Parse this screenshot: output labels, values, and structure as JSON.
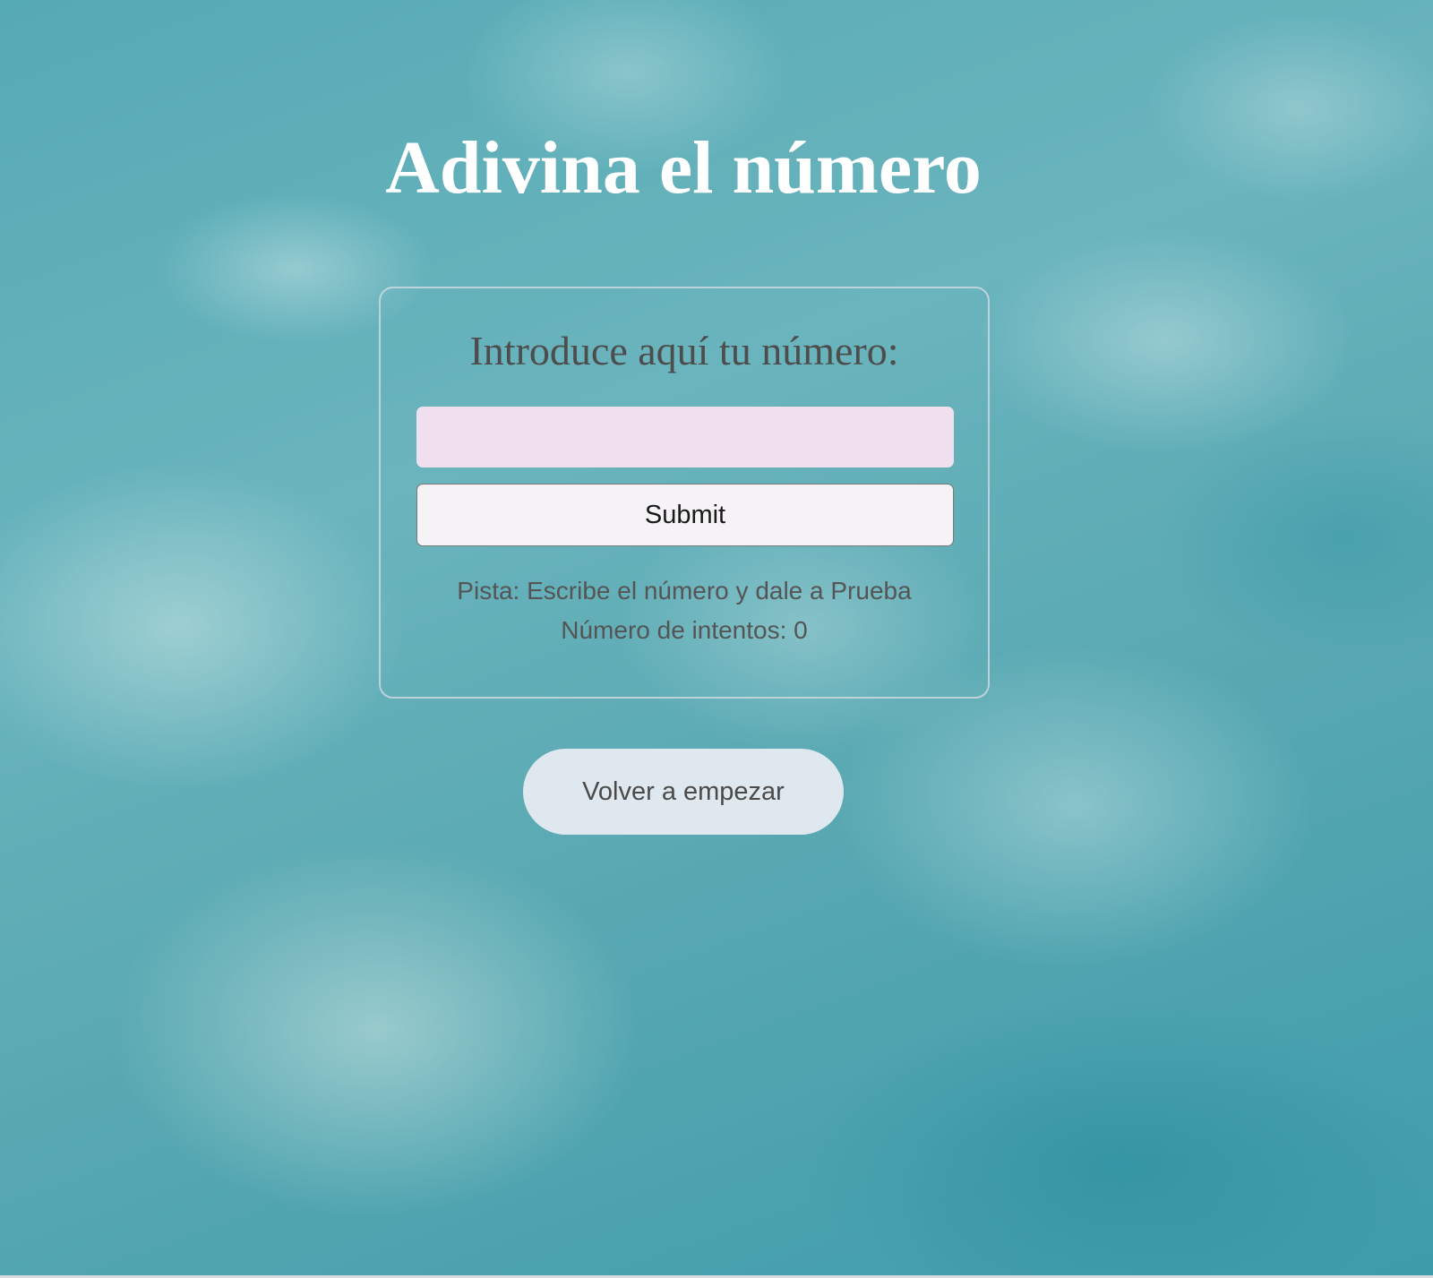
{
  "page": {
    "title": "Adivina el número"
  },
  "form": {
    "heading": "Introduce aquí tu número:",
    "input_value": "",
    "submit_label": "Submit",
    "hint": "Pista: Escribe el número y dale a Prueba",
    "attempts": "Número de intentos: 0"
  },
  "restart": {
    "label": "Volver a empezar"
  },
  "colors": {
    "background": "#4fa6b2",
    "title": "#ffffff",
    "input_background": "#f0dfef",
    "restart_background": "#dfe8ef"
  }
}
